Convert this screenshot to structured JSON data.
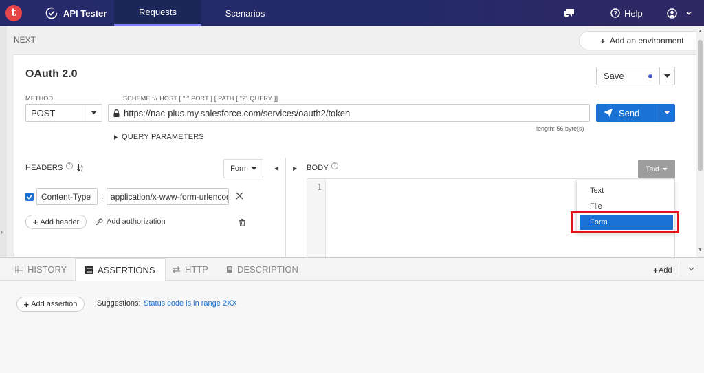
{
  "nav": {
    "logo_letter": "t",
    "app_name": "API Tester",
    "tabs": [
      {
        "label": "Requests",
        "active": true
      },
      {
        "label": "Scenarios",
        "active": false
      }
    ],
    "help_label": "Help"
  },
  "env": {
    "add_label": "Add an environment"
  },
  "section_label": "NEXT",
  "request": {
    "title": "OAuth 2.0",
    "save_label": "Save",
    "method_label": "METHOD",
    "method_value": "POST",
    "url_label": "SCHEME :// HOST [ \":\" PORT ] [ PATH [ \"?\" QUERY ]]",
    "url_value": "https://nac-plus.my.salesforce.com/services/oauth2/token",
    "length_text": "length: 56 byte(s)",
    "send_label": "Send",
    "query_params_label": "QUERY PARAMETERS"
  },
  "headers": {
    "label": "HEADERS",
    "mode_label": "Form",
    "rows": [
      {
        "key": "Content-Type",
        "value": "application/x-www-form-urlencoded",
        "enabled": true
      }
    ],
    "add_header_label": "Add header",
    "add_auth_label": "Add authorization"
  },
  "body": {
    "label": "BODY",
    "type_label": "Text",
    "line_number": "1",
    "dropdown_options": [
      {
        "label": "Text",
        "selected": false
      },
      {
        "label": "File",
        "selected": false
      },
      {
        "label": "Form",
        "selected": true
      }
    ]
  },
  "bottom": {
    "tabs": [
      {
        "label": "HISTORY",
        "active": false
      },
      {
        "label": "ASSERTIONS",
        "active": true
      },
      {
        "label": "HTTP",
        "active": false
      },
      {
        "label": "DESCRIPTION",
        "active": false
      }
    ],
    "add_label": "Add",
    "add_assertion_label": "Add assertion",
    "suggestions_label": "Suggestions:",
    "suggestion_link": "Status code is in range 2XX"
  },
  "colors": {
    "nav_bg": "#262a6c",
    "accent_blue": "#1a73d4",
    "highlight_red": "#e3121c",
    "logo_red": "#e8454b"
  }
}
